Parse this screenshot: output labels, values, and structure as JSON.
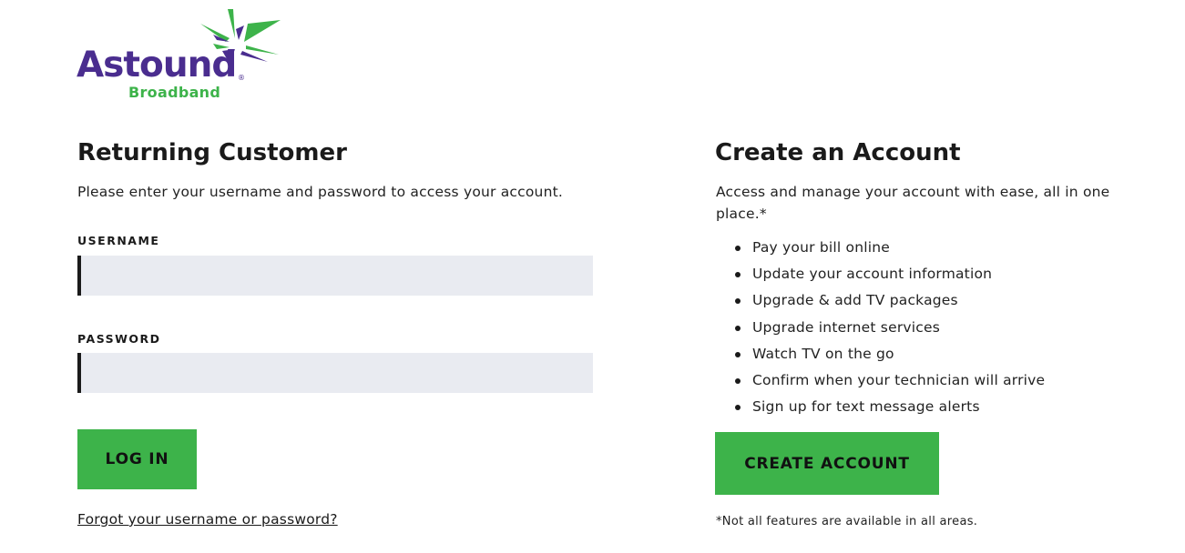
{
  "logo": {
    "brand": "Astound",
    "registered": "®",
    "sub": "Broadband",
    "colors": {
      "purple": "#4a2d8f",
      "green": "#3db34a"
    }
  },
  "login": {
    "title": "Returning Customer",
    "description": "Please enter your username and password to access your account.",
    "username_label": "USERNAME",
    "username_value": "",
    "password_label": "PASSWORD",
    "password_value": "",
    "login_button": "LOG IN",
    "forgot_link": "Forgot your username or password?"
  },
  "create": {
    "title": "Create an Account",
    "description": "Access and manage your account with ease, all in one place.*",
    "features": [
      "Pay your bill online",
      "Update your account information",
      "Upgrade & add TV packages",
      "Upgrade internet services",
      "Watch TV on the go",
      "Confirm when your technician will arrive",
      "Sign up for text message alerts"
    ],
    "create_button": "CREATE ACCOUNT",
    "footnote": "*Not all features are available in all areas."
  },
  "colors": {
    "button_green": "#3db34a",
    "input_bg": "#e9ebf1",
    "text": "#1a1a1a"
  }
}
